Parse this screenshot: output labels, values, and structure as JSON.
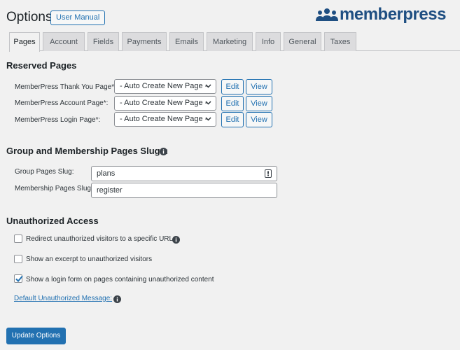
{
  "header": {
    "title": "Options",
    "manual_button": "User Manual",
    "logo": {
      "word1": "member",
      "word2": "press",
      "icon": "people-group-icon"
    }
  },
  "tabs": [
    {
      "label": "Pages",
      "active": true
    },
    {
      "label": "Account",
      "active": false
    },
    {
      "label": "Fields",
      "active": false
    },
    {
      "label": "Payments",
      "active": false
    },
    {
      "label": "Emails",
      "active": false
    },
    {
      "label": "Marketing",
      "active": false
    },
    {
      "label": "Info",
      "active": false
    },
    {
      "label": "General",
      "active": false
    },
    {
      "label": "Taxes",
      "active": false
    }
  ],
  "reserved": {
    "title": "Reserved Pages",
    "rows": [
      {
        "label": "MemberPress Thank You Page*:",
        "value": "- Auto Create New Page -",
        "edit": "Edit",
        "view": "View"
      },
      {
        "label": "MemberPress Account Page*:",
        "value": "- Auto Create New Page -",
        "edit": "Edit",
        "view": "View"
      },
      {
        "label": "MemberPress Login Page*:",
        "value": "- Auto Create New Page -",
        "edit": "Edit",
        "view": "View"
      }
    ]
  },
  "slugs": {
    "title": "Group and Membership Pages Slugs:",
    "group_label": "Group Pages Slug:",
    "group_value": "plans",
    "membership_label": "Membership Pages Slug:",
    "membership_value": "register"
  },
  "unauthorized": {
    "title": "Unauthorized Access",
    "options": [
      {
        "label": "Redirect unauthorized visitors to a specific URL",
        "checked": false,
        "info": true
      },
      {
        "label": "Show an excerpt to unauthorized visitors",
        "checked": false,
        "info": false
      },
      {
        "label": "Show a login form on pages containing unauthorized content",
        "checked": true,
        "info": false
      }
    ],
    "default_message_link": "Default Unauthorized Message:"
  },
  "footer": {
    "update_button": "Update Options"
  },
  "colors": {
    "accent": "#2271b1",
    "logo": "#1f4f82",
    "background": "#f1f1f1"
  }
}
